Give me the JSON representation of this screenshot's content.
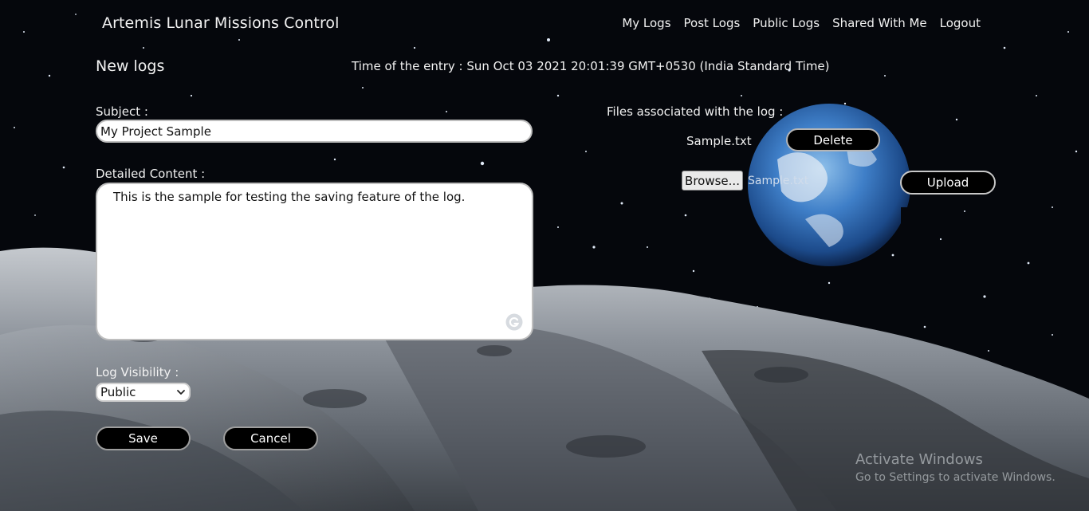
{
  "app": {
    "title": "Artemis Lunar Missions Control"
  },
  "nav": {
    "items": [
      {
        "label": "My Logs"
      },
      {
        "label": "Post Logs"
      },
      {
        "label": "Public Logs"
      },
      {
        "label": "Shared With Me"
      },
      {
        "label": "Logout"
      }
    ]
  },
  "page": {
    "title": "New logs",
    "entry_time": "Time of the entry : Sun Oct 03 2021 20:01:39 GMT+0530 (India Standard Time)"
  },
  "form": {
    "subject_label": "Subject :",
    "subject_value": "My Project Sample",
    "content_label": "Detailed Content :",
    "content_value": "This is the sample for testing the saving feature of the log.",
    "visibility_label": "Log Visibility :",
    "visibility_value": "Public",
    "save_label": "Save",
    "cancel_label": "Cancel"
  },
  "files": {
    "label": "Files associated with the log :",
    "items": [
      {
        "name": "Sample.txt",
        "delete_label": "Delete"
      }
    ],
    "browse_label": "Browse...",
    "selected_file": "Sample.txt",
    "upload_label": "Upload"
  },
  "watermark": {
    "title": "Activate Windows",
    "subtitle": "Go to Settings to activate Windows."
  },
  "icons": {
    "grammar": "grammarly-icon",
    "dropdown": "chevron-down-icon"
  },
  "colors": {
    "space": "#05070c",
    "moon": "#8e949c",
    "earth_blue": "#3f7fc8",
    "button_bg": "#000000"
  }
}
